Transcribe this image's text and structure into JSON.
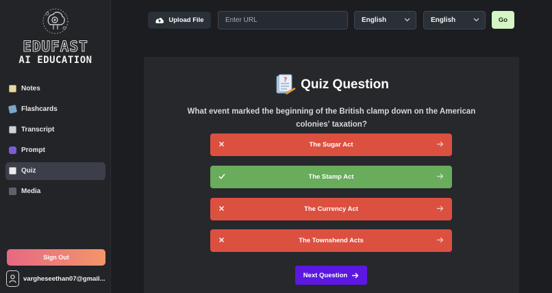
{
  "app": {
    "brand": "EDUFAST",
    "tagline": "AI EDUCATION"
  },
  "sidebar": {
    "items": [
      {
        "label": "Notes",
        "icon": "notes-icon",
        "active": false
      },
      {
        "label": "Flashcards",
        "icon": "flashcards-icon",
        "active": false
      },
      {
        "label": "Transcript",
        "icon": "transcript-icon",
        "active": false
      },
      {
        "label": "Prompt",
        "icon": "prompt-icon",
        "active": false
      },
      {
        "label": "Quiz",
        "icon": "quiz-icon",
        "active": true
      },
      {
        "label": "Media",
        "icon": "media-icon",
        "active": false
      }
    ],
    "sign_out": "Sign Out",
    "user_email": "vargheseethan07@gmail..."
  },
  "topbar": {
    "upload_label": "Upload File",
    "url_placeholder": "Enter URL",
    "url_value": "",
    "source_language": "English",
    "target_language": "English",
    "go_label": "Go"
  },
  "quiz": {
    "title": "Quiz Question",
    "question": "What event marked the beginning of the British clamp down on the American colonies' taxation?",
    "options": [
      {
        "label": "The Sugar Act",
        "status": "wrong"
      },
      {
        "label": "The Stamp Act",
        "status": "correct"
      },
      {
        "label": "The Currency Act",
        "status": "wrong"
      },
      {
        "label": "The Townshend Acts",
        "status": "wrong"
      }
    ],
    "next_label": "Next Question"
  },
  "colors": {
    "wrong": "#dc5040",
    "correct": "#68ac5c",
    "next_button": "#5c18e0",
    "go_button": "#d4f5c4"
  }
}
